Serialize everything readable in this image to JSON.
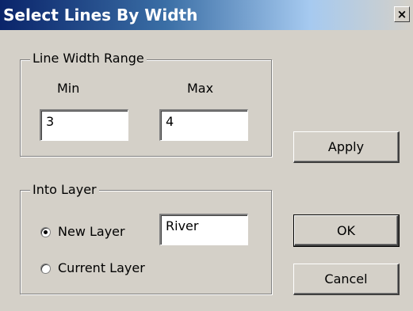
{
  "window": {
    "title": "Select Lines By Width",
    "close_glyph": "×",
    "close_icon": "close-icon"
  },
  "line_width_range": {
    "legend": "Line Width Range",
    "min_label": "Min",
    "max_label": "Max",
    "min_value": "3",
    "max_value": "4"
  },
  "into_layer": {
    "legend": "Into Layer",
    "new_layer_label": "New Layer",
    "new_layer_selected": true,
    "new_layer_name": "River",
    "current_layer_label": "Current Layer",
    "current_layer_selected": false
  },
  "buttons": {
    "apply": "Apply",
    "ok": "OK",
    "cancel": "Cancel"
  }
}
